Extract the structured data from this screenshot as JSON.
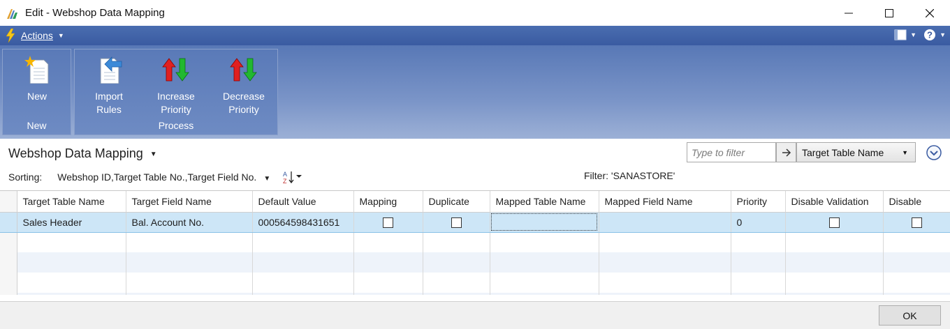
{
  "window": {
    "title": "Edit - Webshop Data Mapping",
    "controls": [
      "minimize",
      "maximize",
      "close"
    ]
  },
  "actionbar": {
    "label": "Actions"
  },
  "ribbon": {
    "groups": [
      {
        "label": "New",
        "buttons": [
          {
            "label_line1": "New",
            "label_line2": "",
            "icon": "new-document-icon"
          }
        ]
      },
      {
        "label": "Process",
        "buttons": [
          {
            "label_line1": "Import",
            "label_line2": "Rules",
            "icon": "import-rules-icon"
          },
          {
            "label_line1": "Increase",
            "label_line2": "Priority",
            "icon": "increase-priority-icon"
          },
          {
            "label_line1": "Decrease",
            "label_line2": "Priority",
            "icon": "decrease-priority-icon"
          }
        ]
      }
    ]
  },
  "page": {
    "title": "Webshop Data Mapping",
    "sorting_label": "Sorting:",
    "sorting_value": "Webshop ID,Target Table No.,Target Field No.",
    "filter_text": "Filter: 'SANASTORE'",
    "filter_placeholder": "Type to filter",
    "filter_field": "Target Table Name"
  },
  "grid": {
    "columns": [
      "Target Table Name",
      "Target Field Name",
      "Default Value",
      "Mapping",
      "Duplicate",
      "Mapped Table Name",
      "Mapped Field Name",
      "Priority",
      "Disable Validation",
      "Disable"
    ],
    "rows": [
      {
        "target_table_name": "Sales Header",
        "target_field_name": "Bal. Account No.",
        "default_value": "000564598431651",
        "mapping": false,
        "duplicate": false,
        "mapped_table_name": "",
        "mapped_field_name": "",
        "priority": "0",
        "disable_validation": false,
        "disable": false
      }
    ]
  },
  "footer": {
    "ok_label": "OK"
  },
  "colors": {
    "ribbon": "#5878b6",
    "actionbar": "#3a5ba1",
    "selected_row": "#cde6f7",
    "alt_row": "#eef3fa"
  }
}
